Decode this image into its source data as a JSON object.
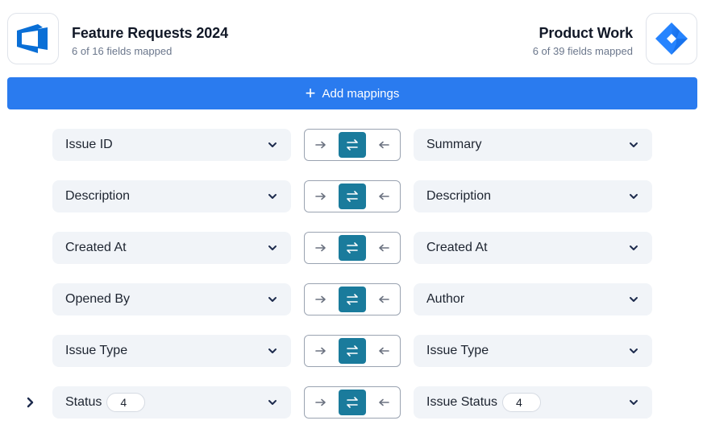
{
  "source": {
    "title": "Feature Requests 2024",
    "subtitle": "6 of 16 fields mapped",
    "logo_icon": "azure-devops-logo-icon"
  },
  "target": {
    "title": "Product Work",
    "subtitle": "6 of 39 fields mapped",
    "logo_icon": "jira-logo-icon"
  },
  "add_button": {
    "icon": "plus-icon",
    "label": "Add mappings"
  },
  "colors": {
    "accent": "#2a7bef",
    "direction_active": "#1a7b9c",
    "field_bg": "#f1f4f8"
  },
  "direction_icons": {
    "left_to_right": "arrow-right-icon",
    "bidirectional": "swap-arrows-icon",
    "right_to_left": "arrow-left-icon"
  },
  "mappings": [
    {
      "source_field": "Issue ID",
      "target_field": "Summary",
      "direction": "bidirectional"
    },
    {
      "source_field": "Description",
      "target_field": "Description",
      "direction": "bidirectional"
    },
    {
      "source_field": "Created At",
      "target_field": "Created At",
      "direction": "bidirectional"
    },
    {
      "source_field": "Opened By",
      "target_field": "Author",
      "direction": "bidirectional"
    },
    {
      "source_field": "Issue Type",
      "target_field": "Issue Type",
      "direction": "bidirectional"
    },
    {
      "source_field": "Status",
      "source_count": "4",
      "target_field": "Issue Status",
      "target_count": "4",
      "direction": "bidirectional",
      "expandable": true
    }
  ]
}
